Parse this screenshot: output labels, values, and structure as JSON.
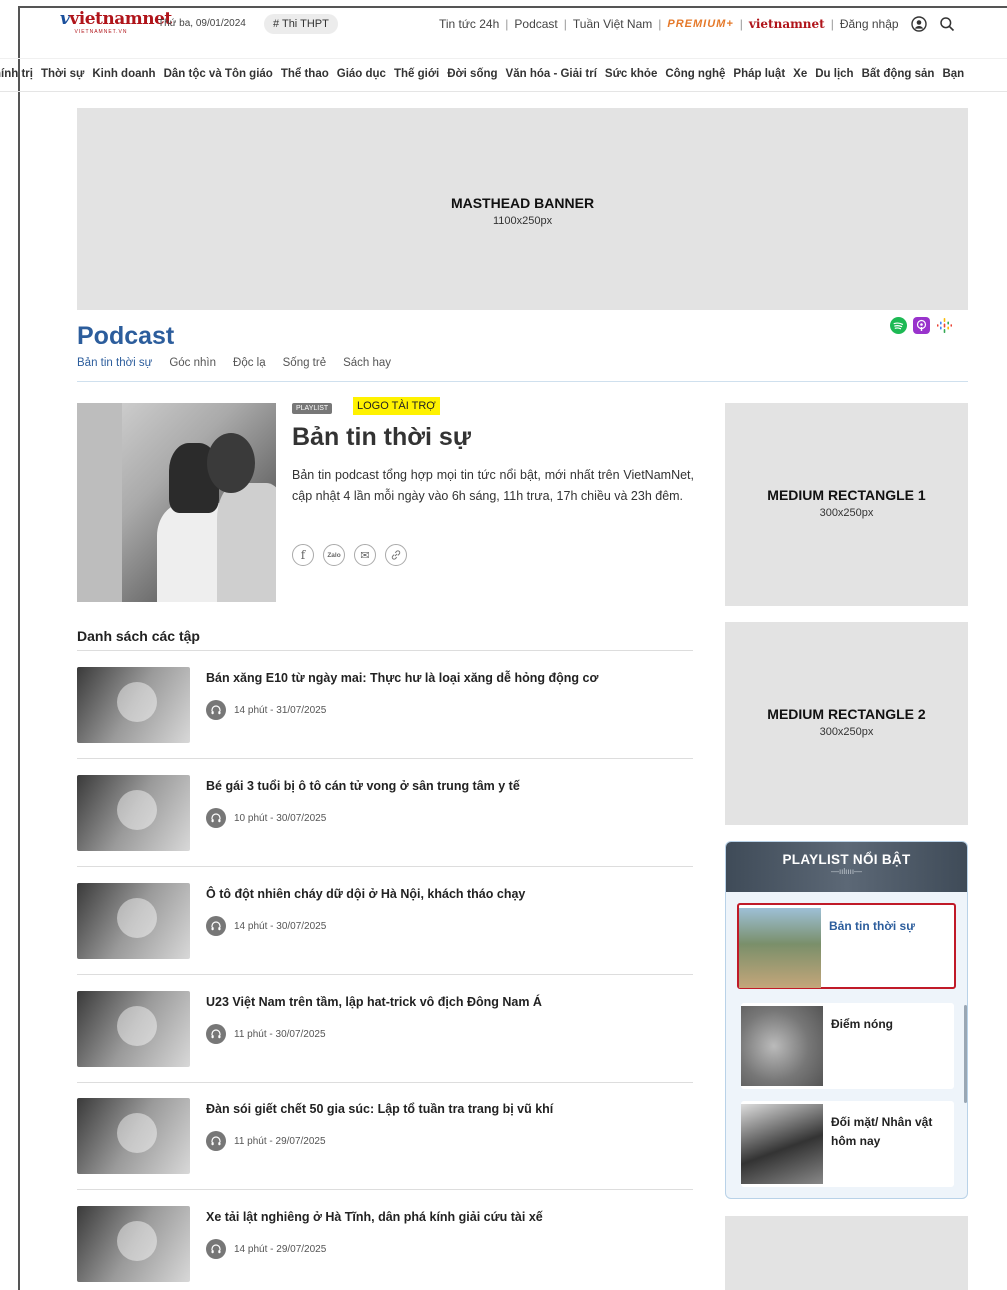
{
  "header": {
    "logo_text": "vietnamnet",
    "logo_sub": "VIETNAMNET.VN",
    "date": "Thứ ba, 09/01/2024",
    "hashtag": "# Thi THPT",
    "links": [
      "Tin tức 24h",
      "Podcast",
      "Tuần Việt Nam"
    ],
    "premium": "PREMIUM+",
    "global_logo": "vietnamnet",
    "login": "Đăng nhập",
    "user_icon": "user-circle-icon",
    "search_icon": "search-icon"
  },
  "category_nav": [
    "hính trị",
    "Thời sự",
    "Kinh doanh",
    "Dân tộc và Tôn giáo",
    "Thể thao",
    "Giáo dục",
    "Thế giới",
    "Đời sống",
    "Văn hóa - Giải trí",
    "Sức khỏe",
    "Công nghệ",
    "Pháp luật",
    "Xe",
    "Du lịch",
    "Bất động sản",
    "Bạn"
  ],
  "masthead": {
    "title": "MASTHEAD BANNER",
    "size": "1100x250px"
  },
  "podcast": {
    "title": "Podcast",
    "tabs": [
      "Bản tin thời sự",
      "Góc nhìn",
      "Độc lạ",
      "Sống trẻ",
      "Sách hay"
    ],
    "active_tab": "Bản tin thời sự",
    "platform_icons": [
      "spotify-icon",
      "apple-podcasts-icon",
      "google-podcasts-icon"
    ],
    "platform_colors": [
      "#1db954",
      "#9933cc",
      "#fbbc04"
    ]
  },
  "hero": {
    "playlist_tag": "PLAYLIST",
    "sponsor": "LOGO TÀI TRỢ",
    "title": "Bản tin thời sự",
    "description": "Bản tin podcast tổng hợp mọi tin tức nổi bật, mới nhất trên VietNamNet, cập nhật 4 lần mỗi ngày vào 6h sáng, 11h trưa, 17h chiều và 23h đêm.",
    "share": {
      "facebook": "f",
      "zalo": "Zalo",
      "email": "✉",
      "link": "🔗"
    }
  },
  "episodes": {
    "heading": "Danh sách các tập",
    "items": [
      {
        "title": "Bán xăng E10 từ ngày mai: Thực hư là loại xăng dễ hỏng động cơ",
        "meta": "14 phút - 31/07/2025"
      },
      {
        "title": "Bé gái 3 tuổi bị ô tô cán tử vong ở sân trung tâm y tế",
        "meta": "10 phút - 30/07/2025"
      },
      {
        "title": "Ô tô đột nhiên cháy dữ dội ở Hà Nội, khách tháo chạy",
        "meta": "14 phút -  30/07/2025"
      },
      {
        "title": "U23 Việt Nam trên tầm, lập hat-trick vô địch Đông Nam Á",
        "meta": "11 phút - 30/07/2025"
      },
      {
        "title": "Đàn sói giết chết 50 gia súc: Lập tổ tuần tra trang bị vũ khí",
        "meta": "11 phút - 29/07/2025"
      },
      {
        "title": "Xe tải lật nghiêng ở Hà Tĩnh, dân phá kính giải cứu tài xế",
        "meta": "14 phút  - 29/07/2025"
      }
    ]
  },
  "ads": {
    "mrect1": {
      "title": "MEDIUM RECTANGLE 1",
      "size": "300x250px"
    },
    "mrect2": {
      "title": "MEDIUM RECTANGLE 2",
      "size": "300x250px"
    }
  },
  "playlist_box": {
    "title": "PLAYLIST NỔI BẬT",
    "items": [
      {
        "label": "Bản tin thời sự",
        "active": true
      },
      {
        "label": "Điểm nóng",
        "active": false
      },
      {
        "label": "Đối mặt/ Nhân vật hôm nay",
        "active": false
      }
    ]
  }
}
